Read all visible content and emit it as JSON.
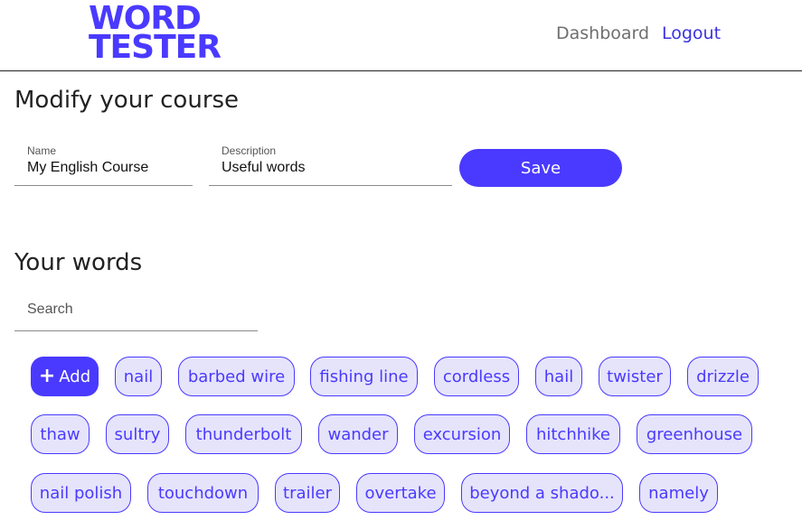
{
  "header": {
    "logo_line1": "WORD",
    "logo_line2": "TESTER",
    "nav": {
      "dashboard": "Dashboard",
      "logout": "Logout"
    }
  },
  "course": {
    "title": "Modify your course",
    "name_label": "Name",
    "name_value": "My English Course",
    "description_label": "Description",
    "description_value": "Useful words",
    "save_label": "Save"
  },
  "words": {
    "title": "Your words",
    "search_placeholder": "Search",
    "add_label": "Add",
    "items": [
      "nail",
      "barbed wire",
      "fishing line",
      "cordless",
      "hail",
      "twister",
      "drizzle",
      "thaw",
      "sultry",
      "thunderbolt",
      "wander",
      "excursion",
      "hitchhike",
      "greenhouse",
      "nail polish",
      "touchdown",
      "trailer",
      "overtake",
      "beyond a shado...",
      "namely"
    ]
  },
  "colors": {
    "accent": "#4a3aff",
    "chip_bg": "#e6e4fb"
  }
}
